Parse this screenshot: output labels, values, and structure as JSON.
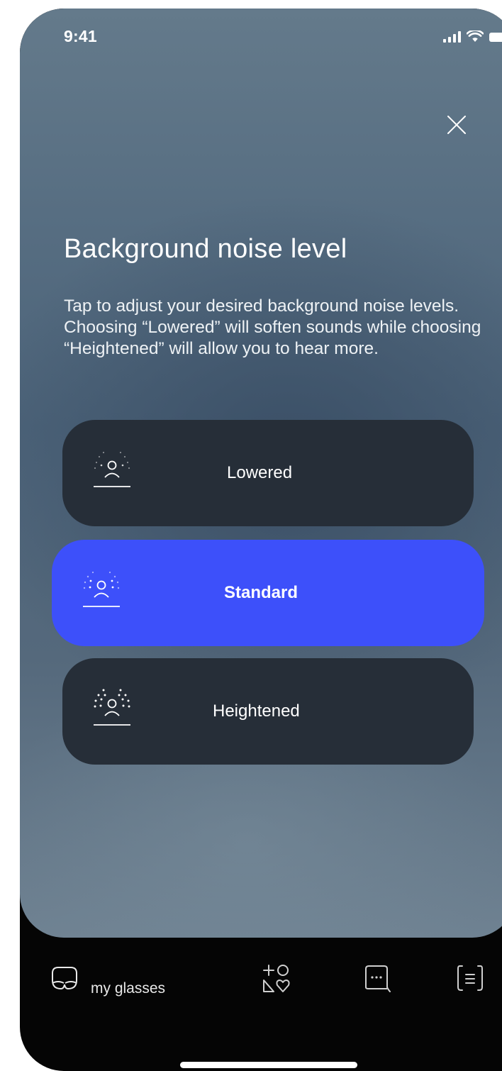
{
  "status_bar": {
    "time": "9:41"
  },
  "header": {
    "close_icon": "close-x-icon"
  },
  "content": {
    "title": "Background noise level",
    "description": "Tap to adjust your desired background noise levels. Choosing “Lowered” will soften sounds while choosing “Heightened” will allow you to hear more."
  },
  "options": [
    {
      "label": "Lowered",
      "icon": "noise-lowered-icon",
      "selected": false
    },
    {
      "label": "Standard",
      "icon": "noise-standard-icon",
      "selected": true
    },
    {
      "label": "Heightened",
      "icon": "noise-heightened-icon",
      "selected": false
    }
  ],
  "nav": {
    "glasses_label": "my glasses",
    "icons": [
      "glasses-icon",
      "shapes-icon",
      "chat-icon",
      "list-icon"
    ]
  },
  "colors": {
    "accent": "#3d50fa",
    "option_bg": "#262e38",
    "nav_bg": "#050505"
  }
}
